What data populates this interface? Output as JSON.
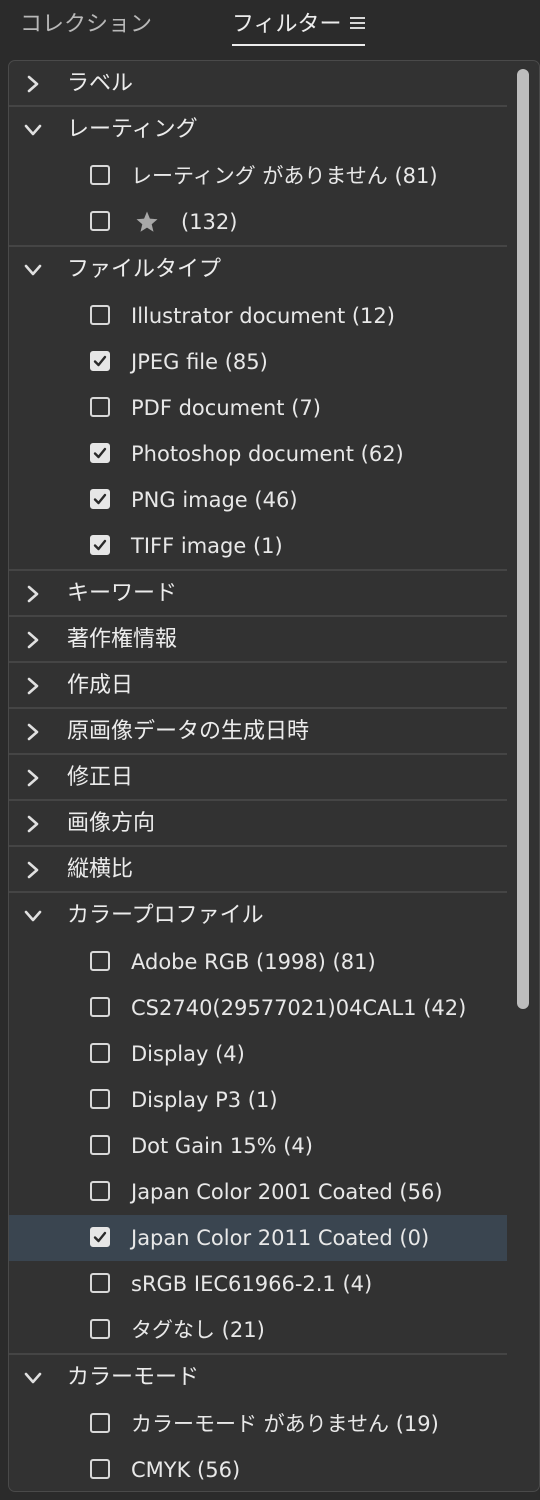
{
  "tabs": {
    "collection": "コレクション",
    "filter": "フィルター"
  },
  "colors": {
    "panel_bg": "#323232",
    "selected_row": "#3a4550",
    "text": "#e8e8e8"
  },
  "icons": {
    "collapsed": "chevron-right-icon",
    "expanded": "chevron-down-icon",
    "menu": "hamburger-menu-icon",
    "rating": "star-icon"
  },
  "sections": [
    {
      "label": "ラベル",
      "expanded": false
    },
    {
      "label": "レーティング",
      "expanded": true,
      "items": [
        {
          "label": "レーティング がありません (81)",
          "checked": false
        },
        {
          "type": "star",
          "count": "(132)",
          "checked": false
        }
      ]
    },
    {
      "label": "ファイルタイプ",
      "expanded": true,
      "items": [
        {
          "label": "Illustrator document (12)",
          "checked": false
        },
        {
          "label": "JPEG file (85)",
          "checked": true
        },
        {
          "label": "PDF document (7)",
          "checked": false
        },
        {
          "label": "Photoshop document (62)",
          "checked": true
        },
        {
          "label": "PNG image (46)",
          "checked": true
        },
        {
          "label": "TIFF image (1)",
          "checked": true
        }
      ]
    },
    {
      "label": "キーワード",
      "expanded": false
    },
    {
      "label": "著作権情報",
      "expanded": false
    },
    {
      "label": "作成日",
      "expanded": false
    },
    {
      "label": "原画像データの生成日時",
      "expanded": false
    },
    {
      "label": "修正日",
      "expanded": false
    },
    {
      "label": "画像方向",
      "expanded": false
    },
    {
      "label": "縦横比",
      "expanded": false
    },
    {
      "label": "カラープロファイル",
      "expanded": true,
      "items": [
        {
          "label": "Adobe RGB (1998) (81)",
          "checked": false
        },
        {
          "label": "CS2740(29577021)04CAL1 (42)",
          "checked": false
        },
        {
          "label": "Display (4)",
          "checked": false
        },
        {
          "label": "Display P3 (1)",
          "checked": false
        },
        {
          "label": "Dot Gain 15% (4)",
          "checked": false
        },
        {
          "label": "Japan Color 2001 Coated (56)",
          "checked": false
        },
        {
          "label": "Japan Color 2011 Coated (0)",
          "checked": true,
          "selected": true
        },
        {
          "label": "sRGB IEC61966-2.1 (4)",
          "checked": false
        },
        {
          "label": "タグなし (21)",
          "checked": false
        }
      ]
    },
    {
      "label": "カラーモード",
      "expanded": true,
      "items": [
        {
          "label": "カラーモード がありません (19)",
          "checked": false
        },
        {
          "label": "CMYK (56)",
          "checked": false
        }
      ]
    }
  ]
}
